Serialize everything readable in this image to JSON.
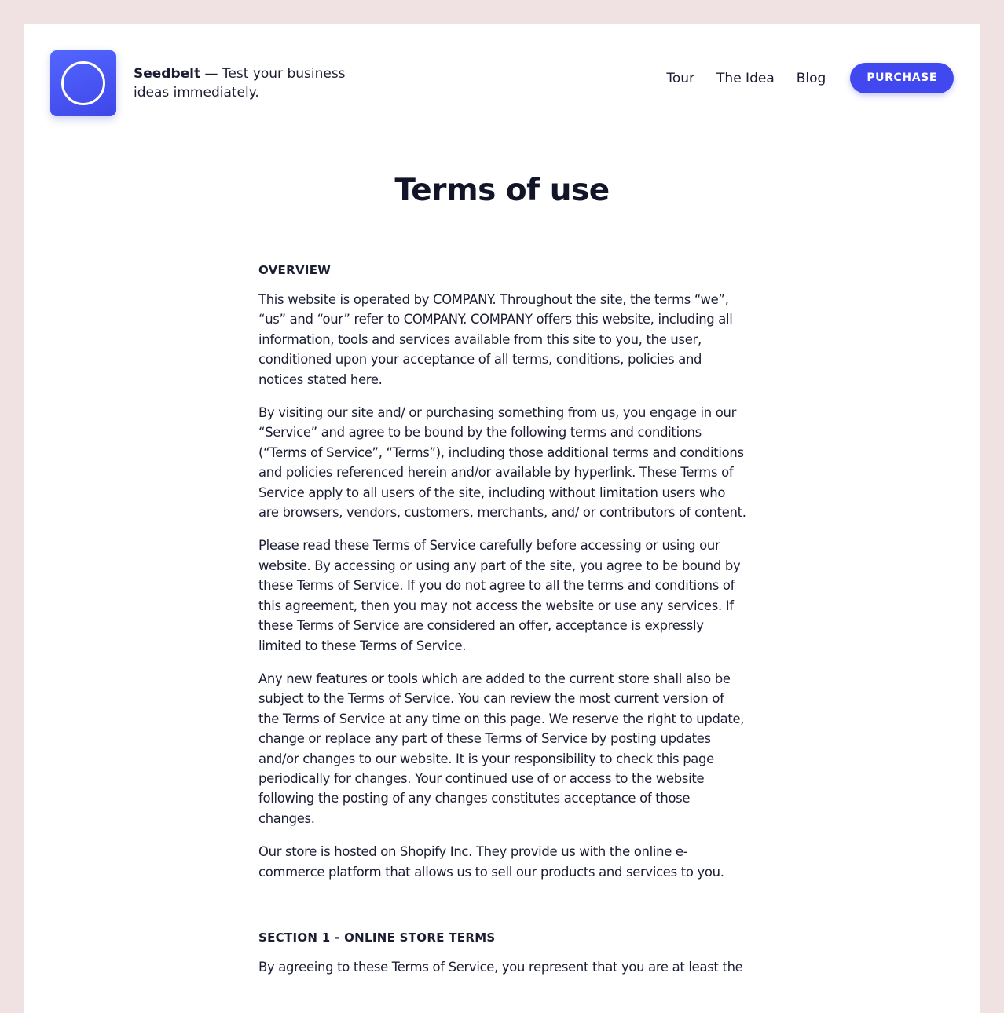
{
  "colors": {
    "page_bg": "#f0e2e2",
    "accent": "#4148f0",
    "text": "#1b1e33"
  },
  "brand": {
    "logo_icon": "circle-ring-logo",
    "name": "Seedbelt",
    "tagline": " — Test your business ideas immediately."
  },
  "nav": {
    "items": [
      "Tour",
      "The Idea",
      "Blog"
    ],
    "purchase": "PURCHASE"
  },
  "page_title": "Terms of use",
  "overview": {
    "heading": "OVERVIEW",
    "paragraphs": [
      "This website is operated by COMPANY. Throughout the site, the terms “we”, “us” and “our” refer to COMPANY. COMPANY offers this website, including all information, tools and services available from this site to you, the user, conditioned upon your acceptance of all terms, conditions, policies and notices stated here.",
      "By visiting our site and/ or purchasing something from us, you engage in our “Service” and agree to be bound by the following terms and conditions (“Terms of Service”, “Terms”), including those additional terms and conditions and policies referenced herein and/or available by hyperlink. These Terms of Service apply  to all users of the site, including without limitation users who are browsers, vendors, customers, merchants, and/ or contributors of content.",
      "Please read these Terms of Service carefully before accessing or using our website. By accessing or using any part of the site, you agree to be bound by these Terms of Service. If you do not agree to all the terms and conditions of this agreement, then you may not access the website or use any services. If these Terms of Service are considered an offer, acceptance is expressly limited to these Terms of Service.",
      "Any new features or tools which are added to the current store shall also be subject to the Terms of Service. You can review the most current version of the Terms of Service at any time on this page. We reserve the right to update, change or replace any part of these Terms of Service by posting updates and/or changes to our website. It is your responsibility to check this page periodically for changes. Your continued use of or access to the website following the posting of any changes constitutes acceptance of those changes.",
      "Our store is hosted on Shopify Inc. They provide us with the online e-commerce platform that allows us to sell our products and services to you."
    ]
  },
  "section1": {
    "heading": "SECTION 1 - ONLINE STORE TERMS",
    "paragraphs": [
      "By agreeing to these Terms of Service, you represent that you are at least the"
    ]
  }
}
